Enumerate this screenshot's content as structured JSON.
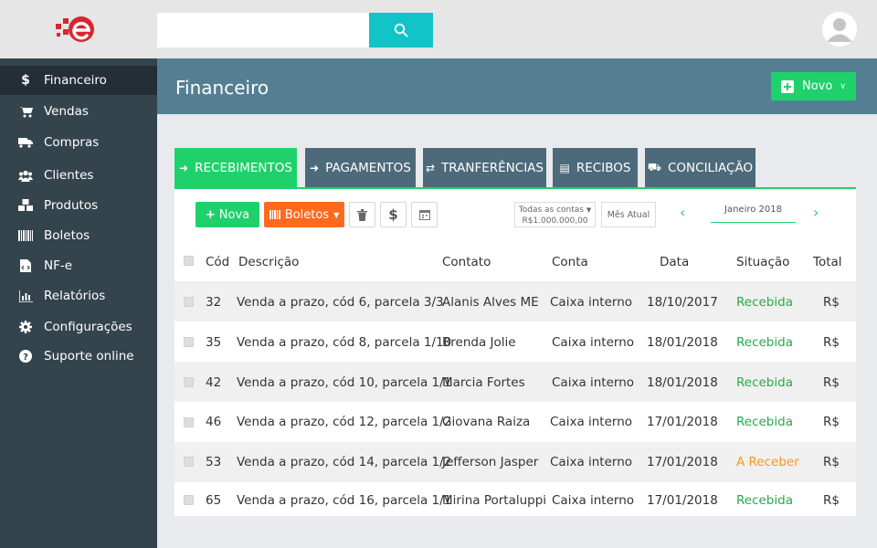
{
  "search": {
    "placeholder": ""
  },
  "sidebar": {
    "items": [
      {
        "label": "Financeiro"
      },
      {
        "label": "Vendas"
      },
      {
        "label": "Compras"
      },
      {
        "label": "Clientes"
      },
      {
        "label": "Produtos"
      },
      {
        "label": "Boletos"
      },
      {
        "label": "NF-e"
      },
      {
        "label": "Relatórios"
      },
      {
        "label": "Configurações"
      },
      {
        "label": "Suporte online"
      }
    ]
  },
  "header": {
    "title": "Financeiro",
    "novo_label": "Novo"
  },
  "tabs": [
    {
      "label": "RECEBIMENTOS"
    },
    {
      "label": "PAGAMENTOS"
    },
    {
      "label": "TRANFERÊNCIAS"
    },
    {
      "label": "RECIBOS"
    },
    {
      "label": "CONCILIAÇÃO"
    }
  ],
  "toolbar": {
    "nova_label": "Nova",
    "boletos_label": "Boletos",
    "accounts_line1": "Todas as contas",
    "accounts_line2": "R$1.000.000,00",
    "mes_atual": "Mês Atual",
    "month": "Janeiro 2018"
  },
  "table": {
    "headers": [
      "Cód",
      "Descrição",
      "Contato",
      "Conta",
      "Data",
      "Situação",
      "Total"
    ],
    "rows": [
      {
        "cod": "32",
        "descricao": "Venda a prazo, cód 6, parcela 3/3",
        "contato": "Alanis Alves ME",
        "conta": "Caixa interno",
        "data": "18/10/2017",
        "situacao": "Recebida",
        "total": "R$"
      },
      {
        "cod": "35",
        "descricao": "Venda a prazo, cód 8, parcela 1/10",
        "contato": "Brenda Jolie",
        "conta": "Caixa interno",
        "data": "18/01/2018",
        "situacao": "Recebida",
        "total": "R$"
      },
      {
        "cod": "42",
        "descricao": "Venda a prazo, cód 10, parcela 1/1",
        "contato": "Marcia Fortes",
        "conta": "Caixa interno",
        "data": "18/01/2018",
        "situacao": "Recebida",
        "total": "R$"
      },
      {
        "cod": "46",
        "descricao": "Venda a prazo, cód 12, parcela 1/2",
        "contato": "Giovana Raiza",
        "conta": "Caixa interno",
        "data": "17/01/2018",
        "situacao": "Recebida",
        "total": "R$"
      },
      {
        "cod": "53",
        "descricao": "Venda a prazo, cód 14, parcela 1/2",
        "contato": "Jefferson Jasper",
        "conta": "Caixa interno",
        "data": "17/01/2018",
        "situacao": "A Receber",
        "total": "R$"
      },
      {
        "cod": "65",
        "descricao": "Venda a prazo, cód 16, parcela 1/1",
        "contato": "Mirina Portaluppi",
        "conta": "Caixa interno",
        "data": "17/01/2018",
        "situacao": "Recebida",
        "total": "R$"
      }
    ]
  },
  "colors": {
    "accent_green": "#1fd16a",
    "accent_orange": "#ff6a1f",
    "teal": "#10c4c7",
    "sidebar": "#34444d",
    "header": "#547f93",
    "tab": "#4d6a7a",
    "status_received": "#2aa84d",
    "status_pending": "#f59a1b"
  },
  "icons": {
    "logo": "e-logo",
    "search": "search-icon",
    "avatar": "user-avatar",
    "sidebar": [
      "dollar-icon",
      "cart-icon",
      "truck-icon",
      "users-icon",
      "cubes-icon",
      "barcode-icon",
      "file-code-icon",
      "bar-chart-icon",
      "gear-icon",
      "question-icon"
    ],
    "tabs": [
      "sign-in-icon",
      "sign-out-icon",
      "exchange-icon",
      "receipt-icon",
      "bank-icon"
    ],
    "toolbar": [
      "plus-icon",
      "barcode-icon",
      "trash-icon",
      "dollar-icon",
      "calendar-icon"
    ]
  }
}
